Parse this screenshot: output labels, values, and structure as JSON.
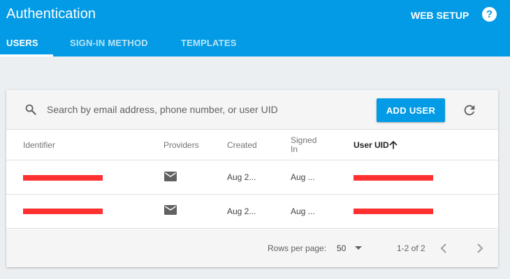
{
  "header": {
    "title": "Authentication",
    "web_setup": "WEB SETUP",
    "help_glyph": "?",
    "tabs": [
      {
        "label": "USERS",
        "active": true
      },
      {
        "label": "SIGN-IN METHOD",
        "active": false
      },
      {
        "label": "TEMPLATES",
        "active": false
      }
    ]
  },
  "toolbar": {
    "search_placeholder": "Search by email address, phone number, or user UID",
    "search_value": "",
    "add_user_label": "ADD USER",
    "icons": [
      "search-icon",
      "refresh-icon"
    ]
  },
  "table": {
    "columns": [
      "Identifier",
      "Providers",
      "Created",
      "Signed In",
      "User UID"
    ],
    "signed_col_lines": [
      "Signed",
      "In"
    ],
    "sorted_column": "User UID",
    "sort_direction": "ascending",
    "rows": [
      {
        "identifier": "[redacted]",
        "provider_icon": "mail-icon",
        "created": "Aug 2...",
        "signed_in": "Aug ...",
        "uid": "[redacted]"
      },
      {
        "identifier": "[redacted]",
        "provider_icon": "mail-icon",
        "created": "Aug 2...",
        "signed_in": "Aug ...",
        "uid": "[redacted]"
      }
    ]
  },
  "footer": {
    "rows_per_page_label": "Rows per page:",
    "rows_per_page_value": "50",
    "range_text": "1-2 of 2"
  },
  "colors": {
    "primary": "#039be5",
    "background": "#eceff1",
    "redaction": "#ff3030"
  }
}
